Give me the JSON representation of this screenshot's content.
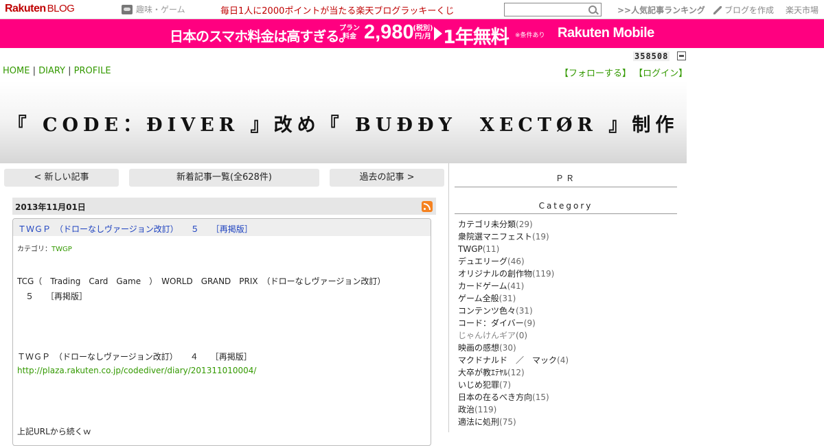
{
  "topbar": {
    "logo_main": "Rakuten",
    "logo_sub": "BLOG",
    "hobby_label": "趣味・ゲーム",
    "lucky_text": "毎日1人に2000ポイントが当たる楽天ブログラッキーくじ",
    "search_value": "",
    "ranking_label": ">>人気記事ランキング",
    "create_label": "ブログを作成",
    "ichiba_label": "楽天市場"
  },
  "banner": {
    "headline": "日本のスマホ料金は高すぎる。",
    "plan_label": "プラン料金",
    "price": "2,980",
    "unit_label": "(税別)円/月",
    "free_label": "1年無料",
    "note": "※条件あり",
    "brand": "Rakuten Mobile",
    "bg_color": "#ff0080"
  },
  "header": {
    "counter": "358508",
    "nav": [
      {
        "label": "HOME"
      },
      {
        "label": "DIARY"
      },
      {
        "label": "PROFILE"
      }
    ],
    "nav_separator": " | ",
    "follow_label": "【フォローする】",
    "login_label": "【ログイン】",
    "blog_title": "『 CODE：ĐIVER 』改め『 BUĐĐY　XECTØR 』制作"
  },
  "pager": {
    "newer": "< 新しい記事",
    "list": "新着記事一覧(全628件)",
    "older": "過去の記事 >"
  },
  "entry": {
    "date": "2013年11月01日",
    "title": "ＴＷＧＰ　（ドローなしヴァージョン改訂）　　５　　［再掲版］",
    "category_prefix": "カテゴリ：",
    "category": "TWGP",
    "body_line1": "TCG（　Trading　Card　Game　）　WORLD　GRAND　PRIX　（ドローなしヴァージョン改訂）",
    "body_line2": "　５　　［再掲版］",
    "body_line3": "ＴＷＧＰ　（ドローなしヴァージョン改訂）　　４　　［再掲版］",
    "body_link": "http://plaza.rakuten.co.jp/codediver/diary/201311010004/",
    "body_line4": "上記URLから続くｗ"
  },
  "sidebar": {
    "pr_heading": "ＰＲ",
    "category_heading": "Category",
    "categories": [
      {
        "name": "カテゴリ未分類",
        "count": "(29)"
      },
      {
        "name": "衆院選マニフェスト",
        "count": "(19)"
      },
      {
        "name": "TWGP",
        "count": "(11)"
      },
      {
        "name": "デュエリーグ",
        "count": "(46)"
      },
      {
        "name": "オリジナルの創作物",
        "count": "(119)"
      },
      {
        "name": "カードゲーム",
        "count": "(41)"
      },
      {
        "name": "ゲーム全般",
        "count": "(31)"
      },
      {
        "name": "コンテンツ色々",
        "count": "(31)"
      },
      {
        "name": "コード：ダイバー",
        "count": "(9)"
      },
      {
        "name": "じゃんけんギア",
        "count": "(0)"
      },
      {
        "name": "映画の感想",
        "count": "(30)"
      },
      {
        "name": "マクドナルド　／　マック",
        "count": "(4)"
      },
      {
        "name": "大卒が教ｴﾃﾔﾙ",
        "count": "(12)"
      },
      {
        "name": "いじめ犯罪",
        "count": "(7)"
      },
      {
        "name": "日本の在るべき方向",
        "count": "(15)"
      },
      {
        "name": "政治",
        "count": "(119)"
      },
      {
        "name": "適法に処刑",
        "count": "(75)"
      }
    ]
  }
}
